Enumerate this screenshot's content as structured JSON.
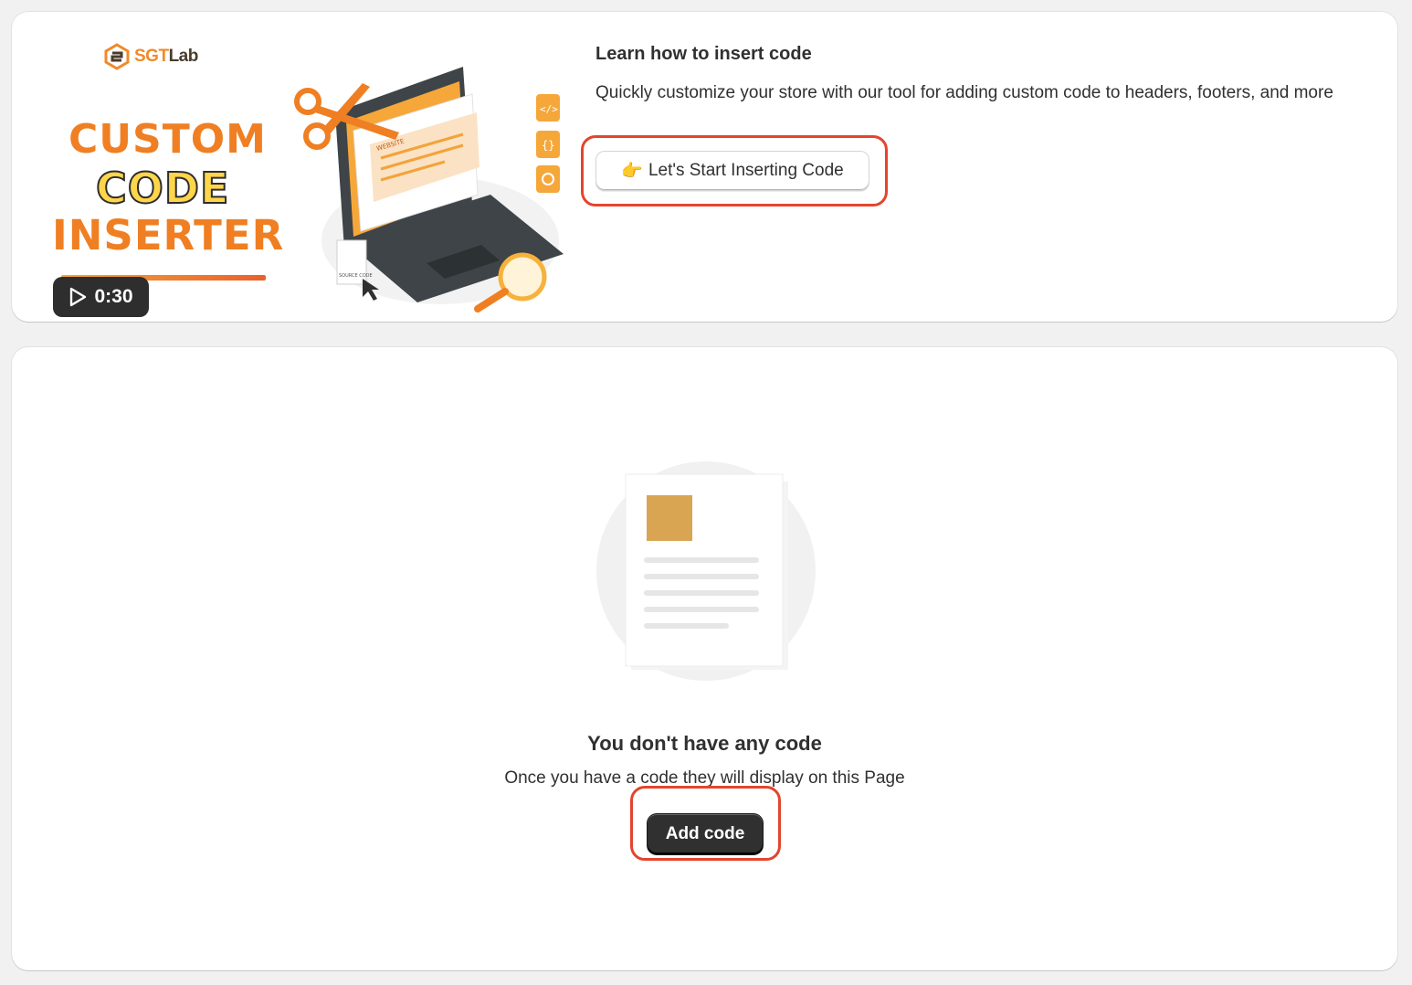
{
  "promo": {
    "brand": {
      "sgt": "SGT",
      "lab": "Lab"
    },
    "title_lines": [
      "CUSTOM",
      "CODE",
      "INSERTER"
    ],
    "video_duration": "0:30",
    "illustration_labels": {
      "website": "WEBSITE",
      "source_code": "SOURCE CODE"
    },
    "heading": "Learn how to insert code",
    "description": "Quickly customize your store with our tool for adding custom code to headers, footers, and more",
    "cta_label": "Let's Start Inserting Code",
    "cta_icon": "pointing-hand-icon"
  },
  "empty_state": {
    "title": "You don't have any code",
    "subtitle": "Once you have a code they will display on this Page",
    "button_label": "Add code"
  },
  "colors": {
    "highlight": "#e3452d",
    "brand_orange": "#ef7f22",
    "primary_button": "#303030",
    "background": "#f1f1f1"
  }
}
